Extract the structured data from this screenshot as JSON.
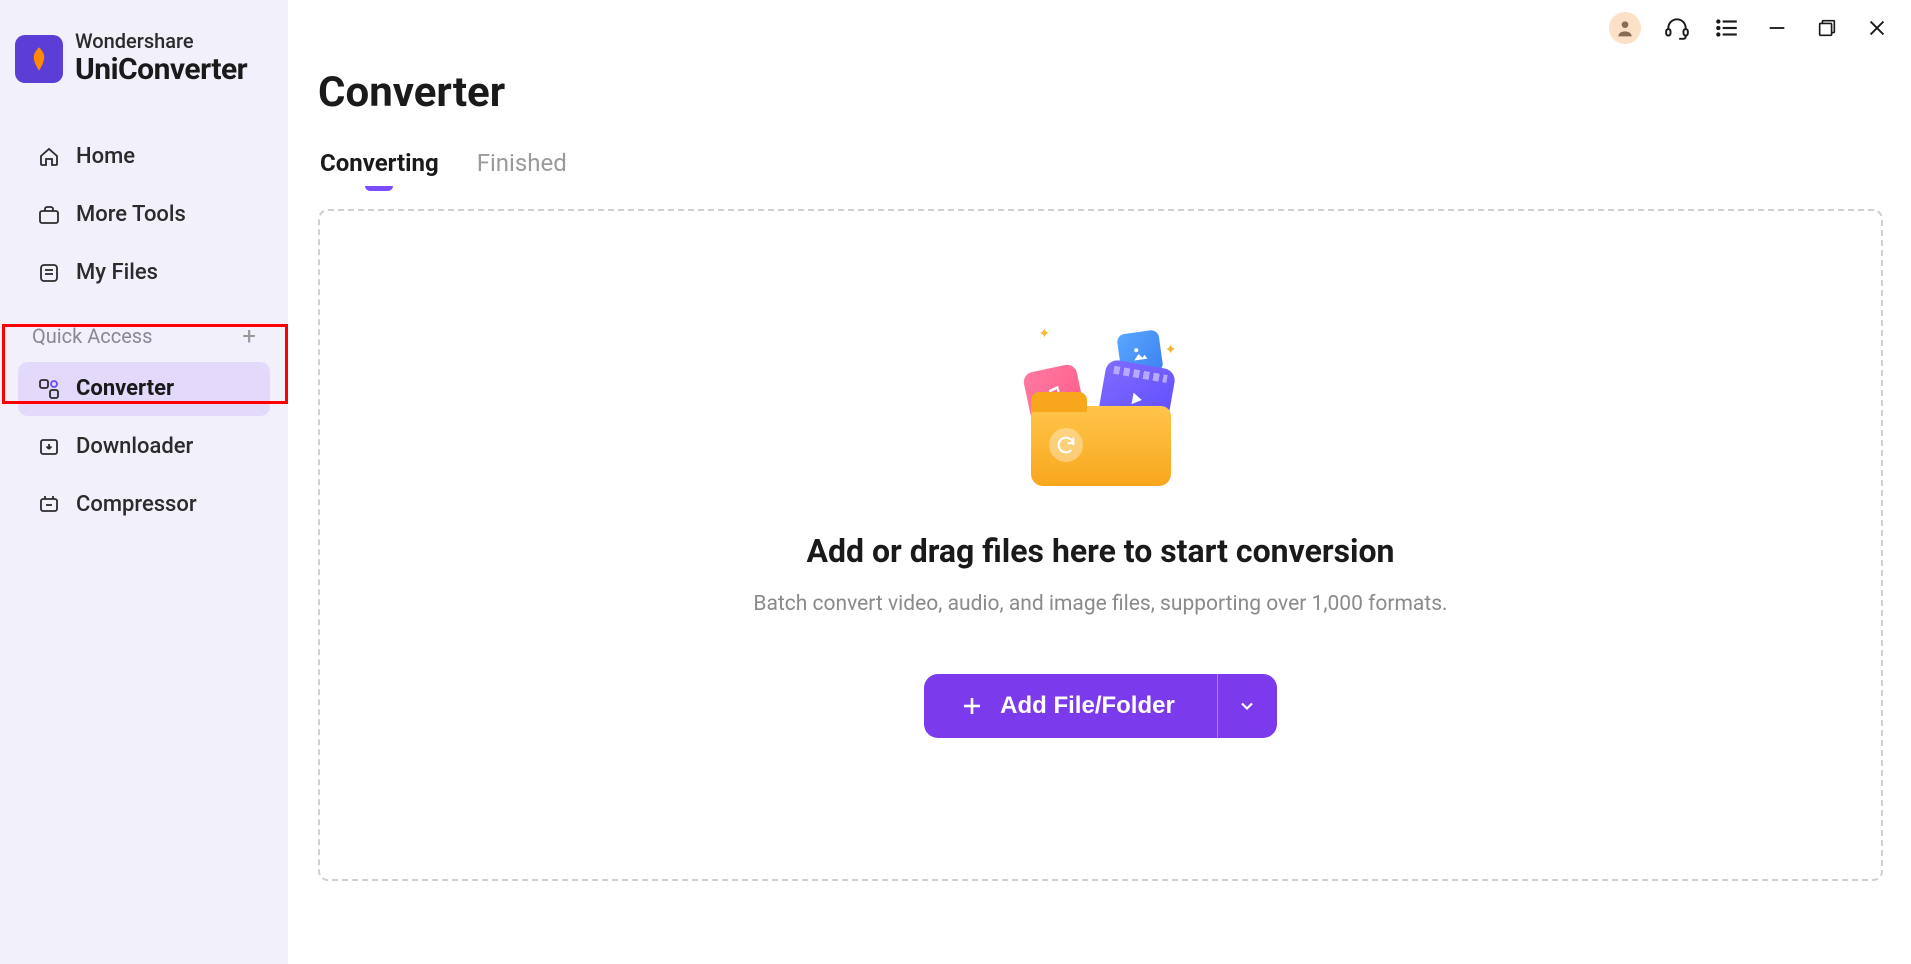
{
  "brand": {
    "parent": "Wondershare",
    "product": "UniConverter"
  },
  "sidebar": {
    "items": [
      {
        "label": "Home"
      },
      {
        "label": "More Tools"
      },
      {
        "label": "My Files"
      }
    ],
    "section_label": "Quick Access",
    "quick": [
      {
        "label": "Converter"
      },
      {
        "label": "Downloader"
      },
      {
        "label": "Compressor"
      }
    ]
  },
  "page": {
    "title": "Converter"
  },
  "tabs": [
    {
      "label": "Converting",
      "active": true
    },
    {
      "label": "Finished",
      "active": false
    }
  ],
  "dropzone": {
    "title": "Add or drag files here to start conversion",
    "subtitle": "Batch convert video, audio, and image files, supporting over 1,000 formats.",
    "button_label": "Add File/Folder"
  },
  "colors": {
    "accent": "#7c3aed",
    "highlight_border": "#ff0000"
  }
}
